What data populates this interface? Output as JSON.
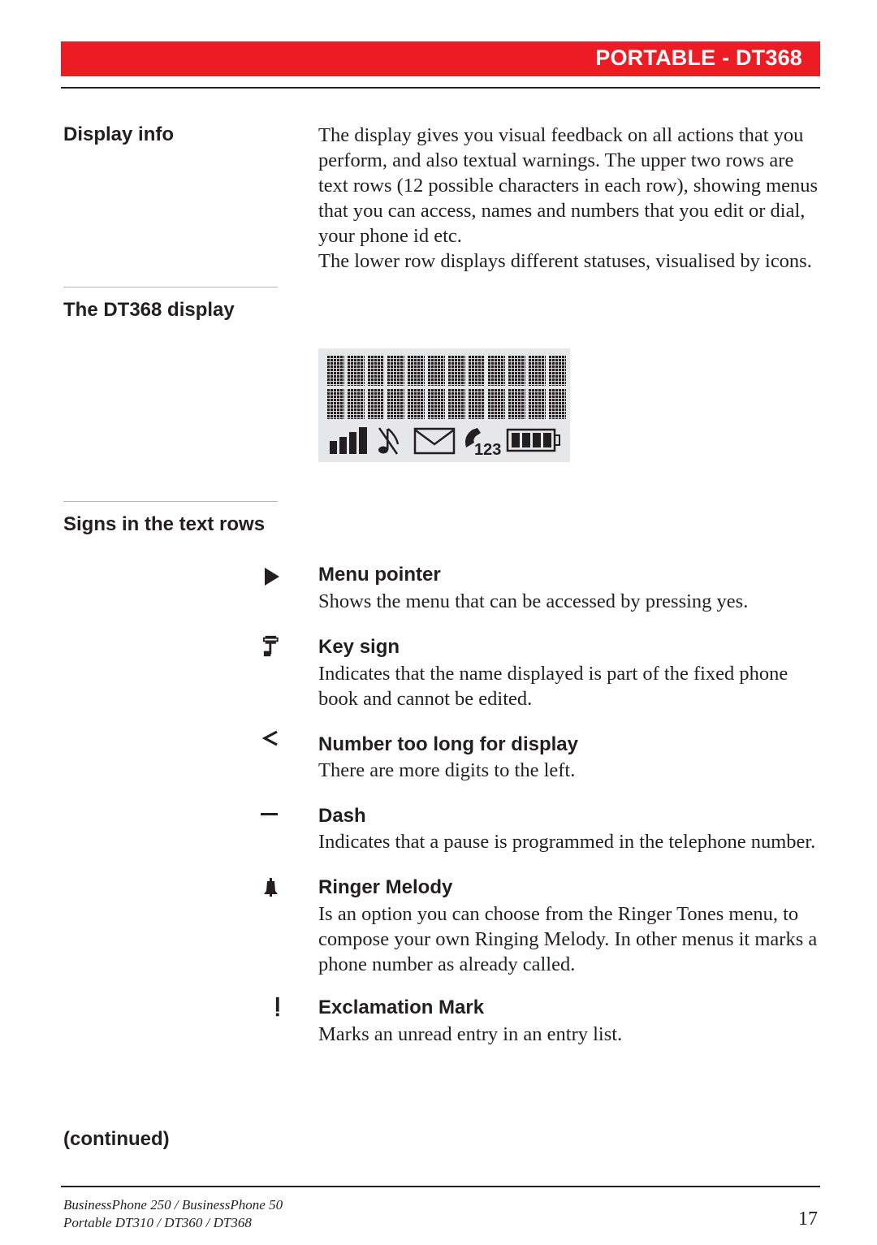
{
  "header": {
    "title": "PORTABLE - DT368",
    "bar_color": "#ed1c24"
  },
  "display_info": {
    "heading": "Display info",
    "paragraphs": [
      "The display gives you visual feedback on all actions that you perform, and also textual warnings. The upper two rows are text rows (12 possible characters in each row), showing menus that you can access, names and numbers that you edit or dial, your phone id etc.",
      "The lower row displays different statuses, visualised by icons."
    ]
  },
  "dt368_display": {
    "heading": "The DT368 display",
    "text_rows": 2,
    "chars_per_row": 12,
    "status_icons": [
      "signal-strength-icon",
      "silent-note-icon",
      "message-envelope-icon",
      "missed-call-123-icon",
      "battery-full-icon"
    ],
    "missed_call_label": "123",
    "battery_bars": 4,
    "signal_bars": 4
  },
  "signs": {
    "heading": "Signs in the text rows",
    "items": [
      {
        "icon": "menu-pointer-icon",
        "title": "Menu pointer",
        "description": "Shows the menu that can be accessed by pressing yes."
      },
      {
        "icon": "key-sign-icon",
        "title": "Key sign",
        "description": "Indicates that the name displayed is part of the fixed phone book and cannot be edited."
      },
      {
        "icon": "less-than-icon",
        "glyph": "<",
        "title": "Number too long for display",
        "description": "There are more digits to the left."
      },
      {
        "icon": "dash-icon",
        "title": "Dash",
        "description": "Indicates that a pause is programmed in the telephone number."
      },
      {
        "icon": "bell-icon",
        "title": "Ringer Melody",
        "description": "Is an option you can choose from the Ringer Tones menu, to compose your own Ringing Melody. In other menus it marks a phone number as already called."
      },
      {
        "icon": "exclamation-icon",
        "glyph": "!",
        "title": "Exclamation Mark",
        "description": "Marks an unread entry in an entry list."
      }
    ]
  },
  "continued_label": "(continued)",
  "footer": {
    "line1": "BusinessPhone 250 / BusinessPhone 50",
    "line2": "Portable DT310 / DT360 / DT368",
    "page_number": "17"
  }
}
